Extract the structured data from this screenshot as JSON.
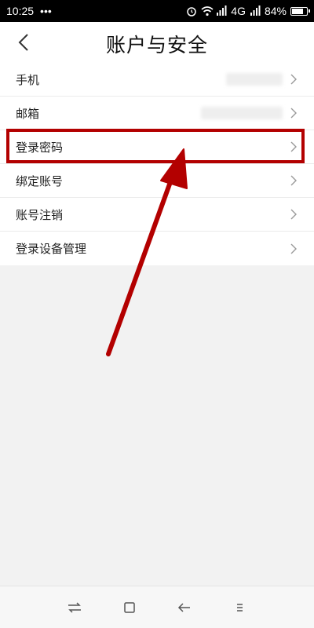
{
  "status_bar": {
    "time": "10:25",
    "more_dots": "•••",
    "network": "4G",
    "battery_percent": "84%",
    "battery_level": 0.84
  },
  "header": {
    "title": "账户与安全"
  },
  "menu": {
    "items": [
      {
        "label": "手机",
        "value_blurred": true
      },
      {
        "label": "邮箱",
        "value_blurred": true
      },
      {
        "label": "登录密码",
        "highlighted": true
      },
      {
        "label": "绑定账号"
      },
      {
        "label": "账号注销"
      },
      {
        "label": "登录设备管理"
      }
    ]
  },
  "colors": {
    "annotation_red": "#b30000",
    "background": "#f2f2f2"
  },
  "icons": {
    "back": "chevron-left-icon",
    "row": "chevron-right-icon",
    "nav": [
      "switch-apps-icon",
      "home-icon",
      "back-icon",
      "menu-icon"
    ]
  }
}
